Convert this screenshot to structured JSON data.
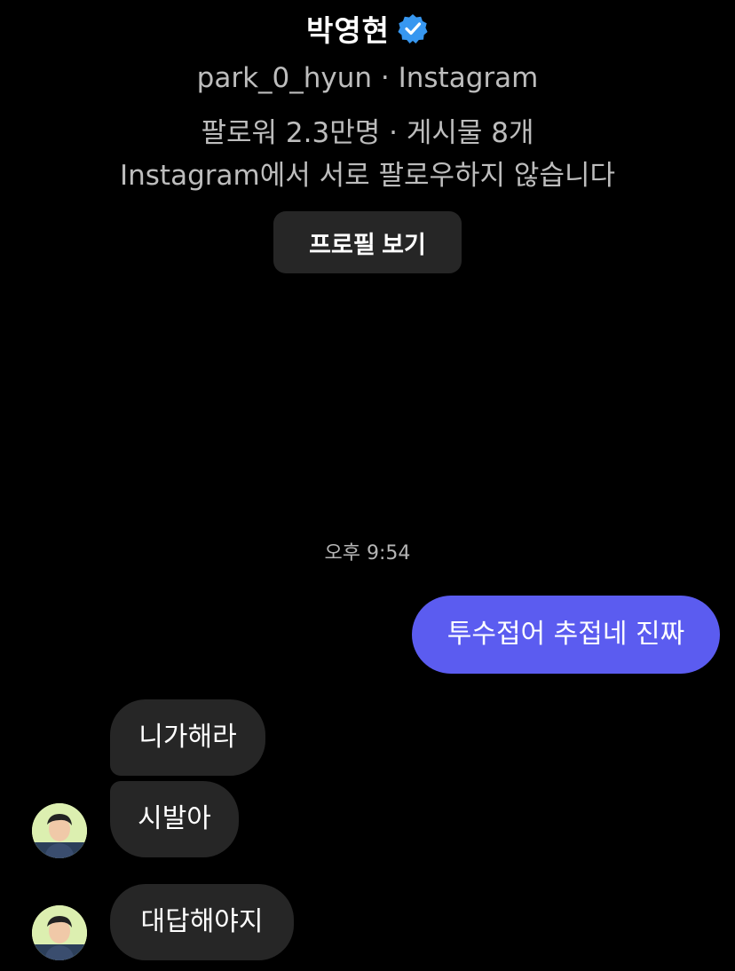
{
  "profile": {
    "display_name": "박영현",
    "verified_icon": "verified-badge-icon",
    "handle_line": "park_0_hyun · Instagram",
    "stats_line": "팔로워 2.3만명 · 게시물 8개",
    "follow_status": "Instagram에서 서로 팔로우하지 않습니다",
    "view_profile_label": "프로필 보기"
  },
  "conversation": {
    "timestamp": "오후 9:54",
    "messages": [
      {
        "direction": "sent",
        "text": "투수접어 추접네 진짜"
      },
      {
        "direction": "received",
        "text": "니가해라"
      },
      {
        "direction": "received",
        "text": "시발아"
      },
      {
        "direction": "received",
        "text": "대답해야지"
      }
    ]
  },
  "colors": {
    "background": "#000000",
    "sent_bubble": "#5b5cf0",
    "received_bubble": "#262626",
    "verified_badge": "#3797f0",
    "secondary_text": "#bdbdbd"
  }
}
